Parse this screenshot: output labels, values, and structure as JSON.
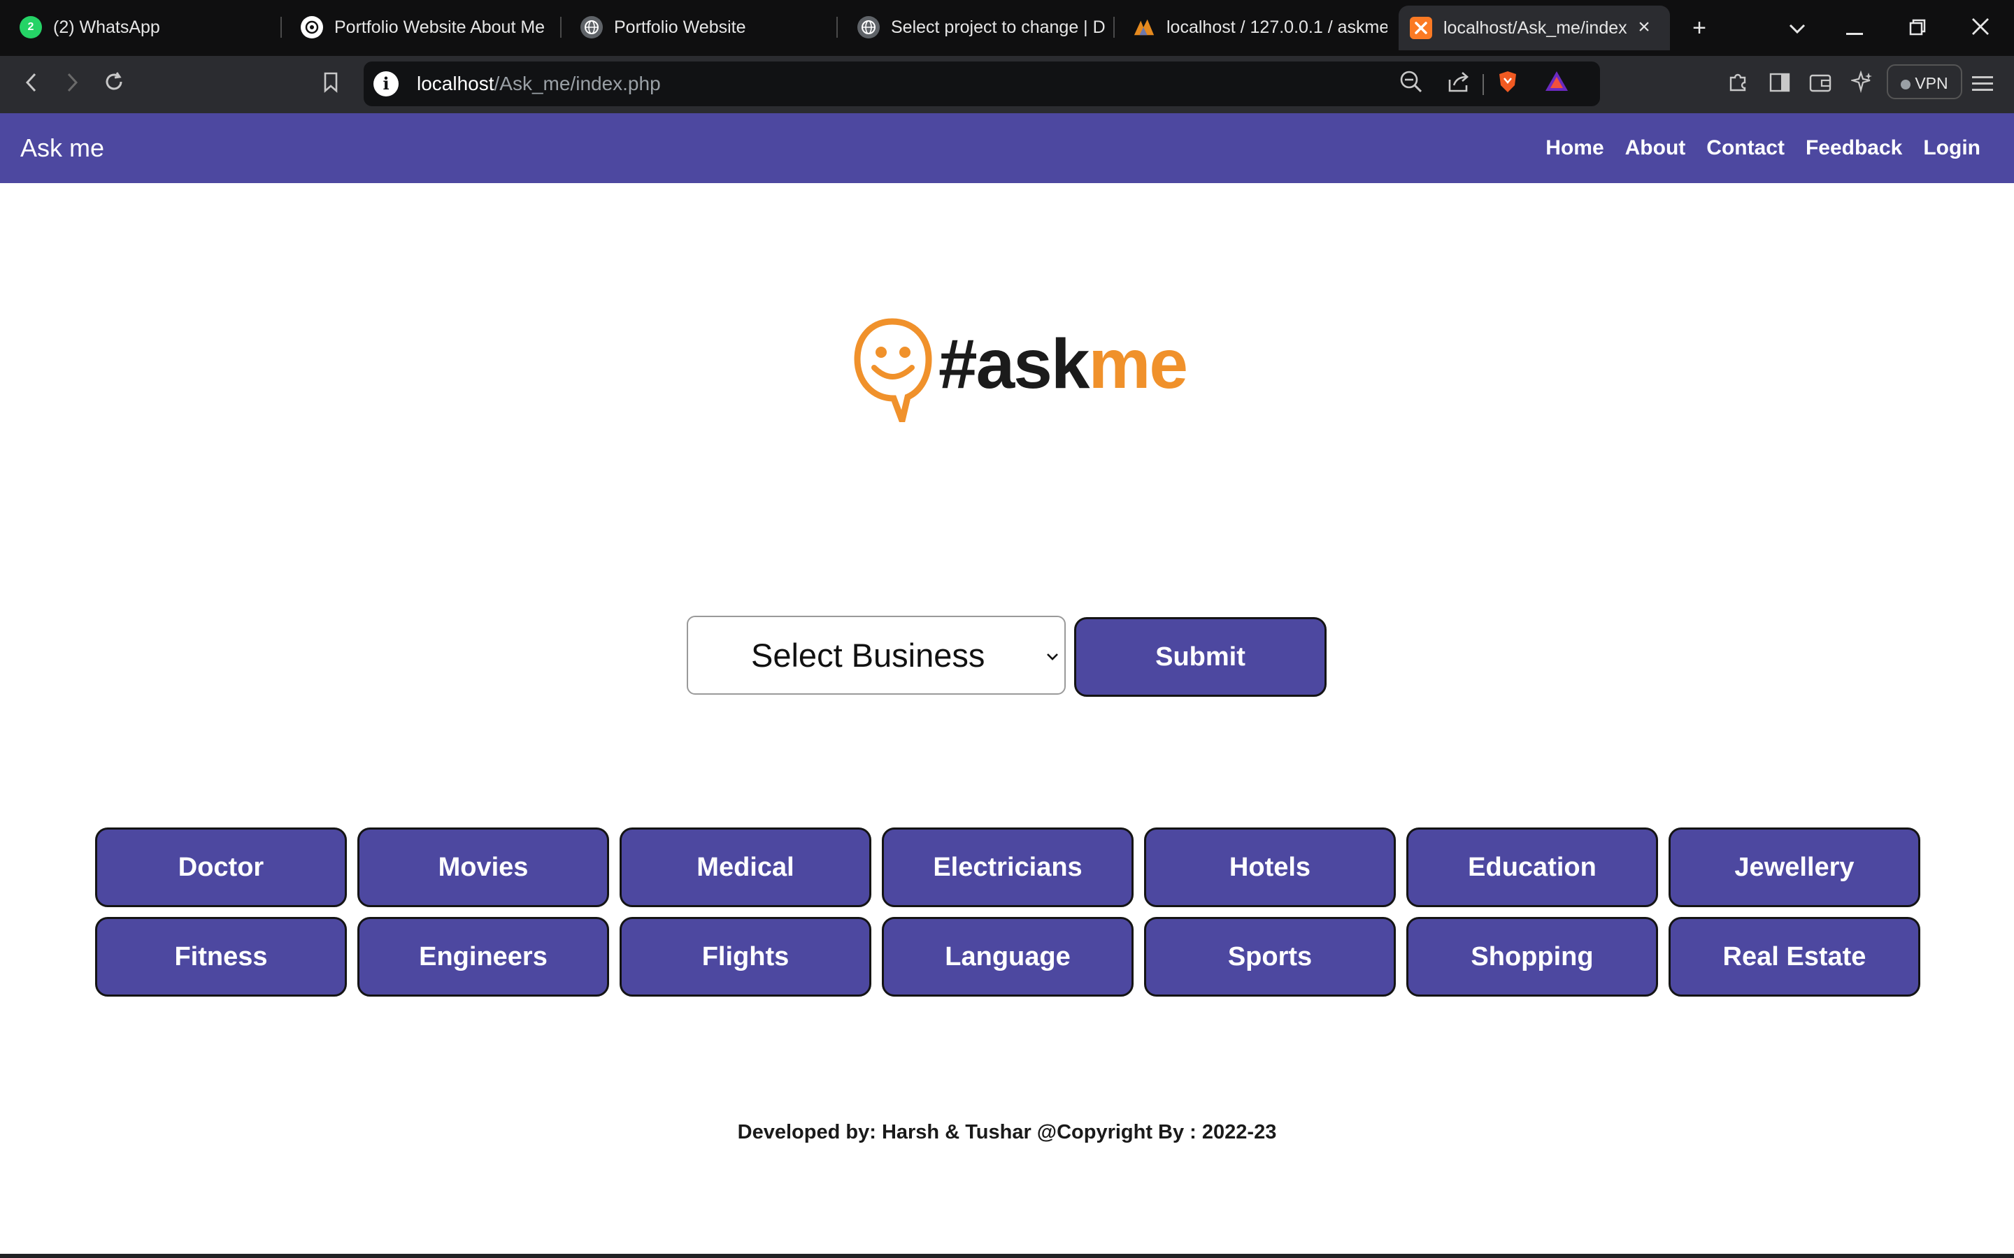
{
  "browser": {
    "tabs": [
      {
        "title": "(2) WhatsApp",
        "icon": "whatsapp-icon",
        "badge": "2"
      },
      {
        "title": "Portfolio Website About Me",
        "icon": "chatgpt-icon"
      },
      {
        "title": "Portfolio Website",
        "icon": "globe-icon"
      },
      {
        "title": "Select project to change | Dj",
        "icon": "globe-icon"
      },
      {
        "title": "localhost / 127.0.0.1 / askme",
        "icon": "phpmyadmin-icon"
      },
      {
        "title": "localhost/Ask_me/index",
        "icon": "xampp-icon",
        "active": true
      }
    ],
    "address": {
      "host": "localhost",
      "path": "/Ask_me/index.php"
    },
    "vpn_label": "VPN"
  },
  "site": {
    "brand": "Ask me",
    "nav": [
      "Home",
      "About",
      "Contact",
      "Feedback",
      "Login"
    ],
    "logo": {
      "hash_text": "#ask",
      "me_text": "me"
    },
    "form": {
      "select_value": "Select Business",
      "submit_label": "Submit"
    },
    "categories": [
      "Doctor",
      "Movies",
      "Medical",
      "Electricians",
      "Hotels",
      "Education",
      "Jewellery",
      "Fitness",
      "Engineers",
      "Flights",
      "Language",
      "Sports",
      "Shopping",
      "Real Estate"
    ],
    "footer": "Developed by: Harsh & Tushar @Copyright By : 2022-23"
  },
  "colors": {
    "brand_purple": "#4d48a0",
    "logo_orange": "#f0912b"
  }
}
